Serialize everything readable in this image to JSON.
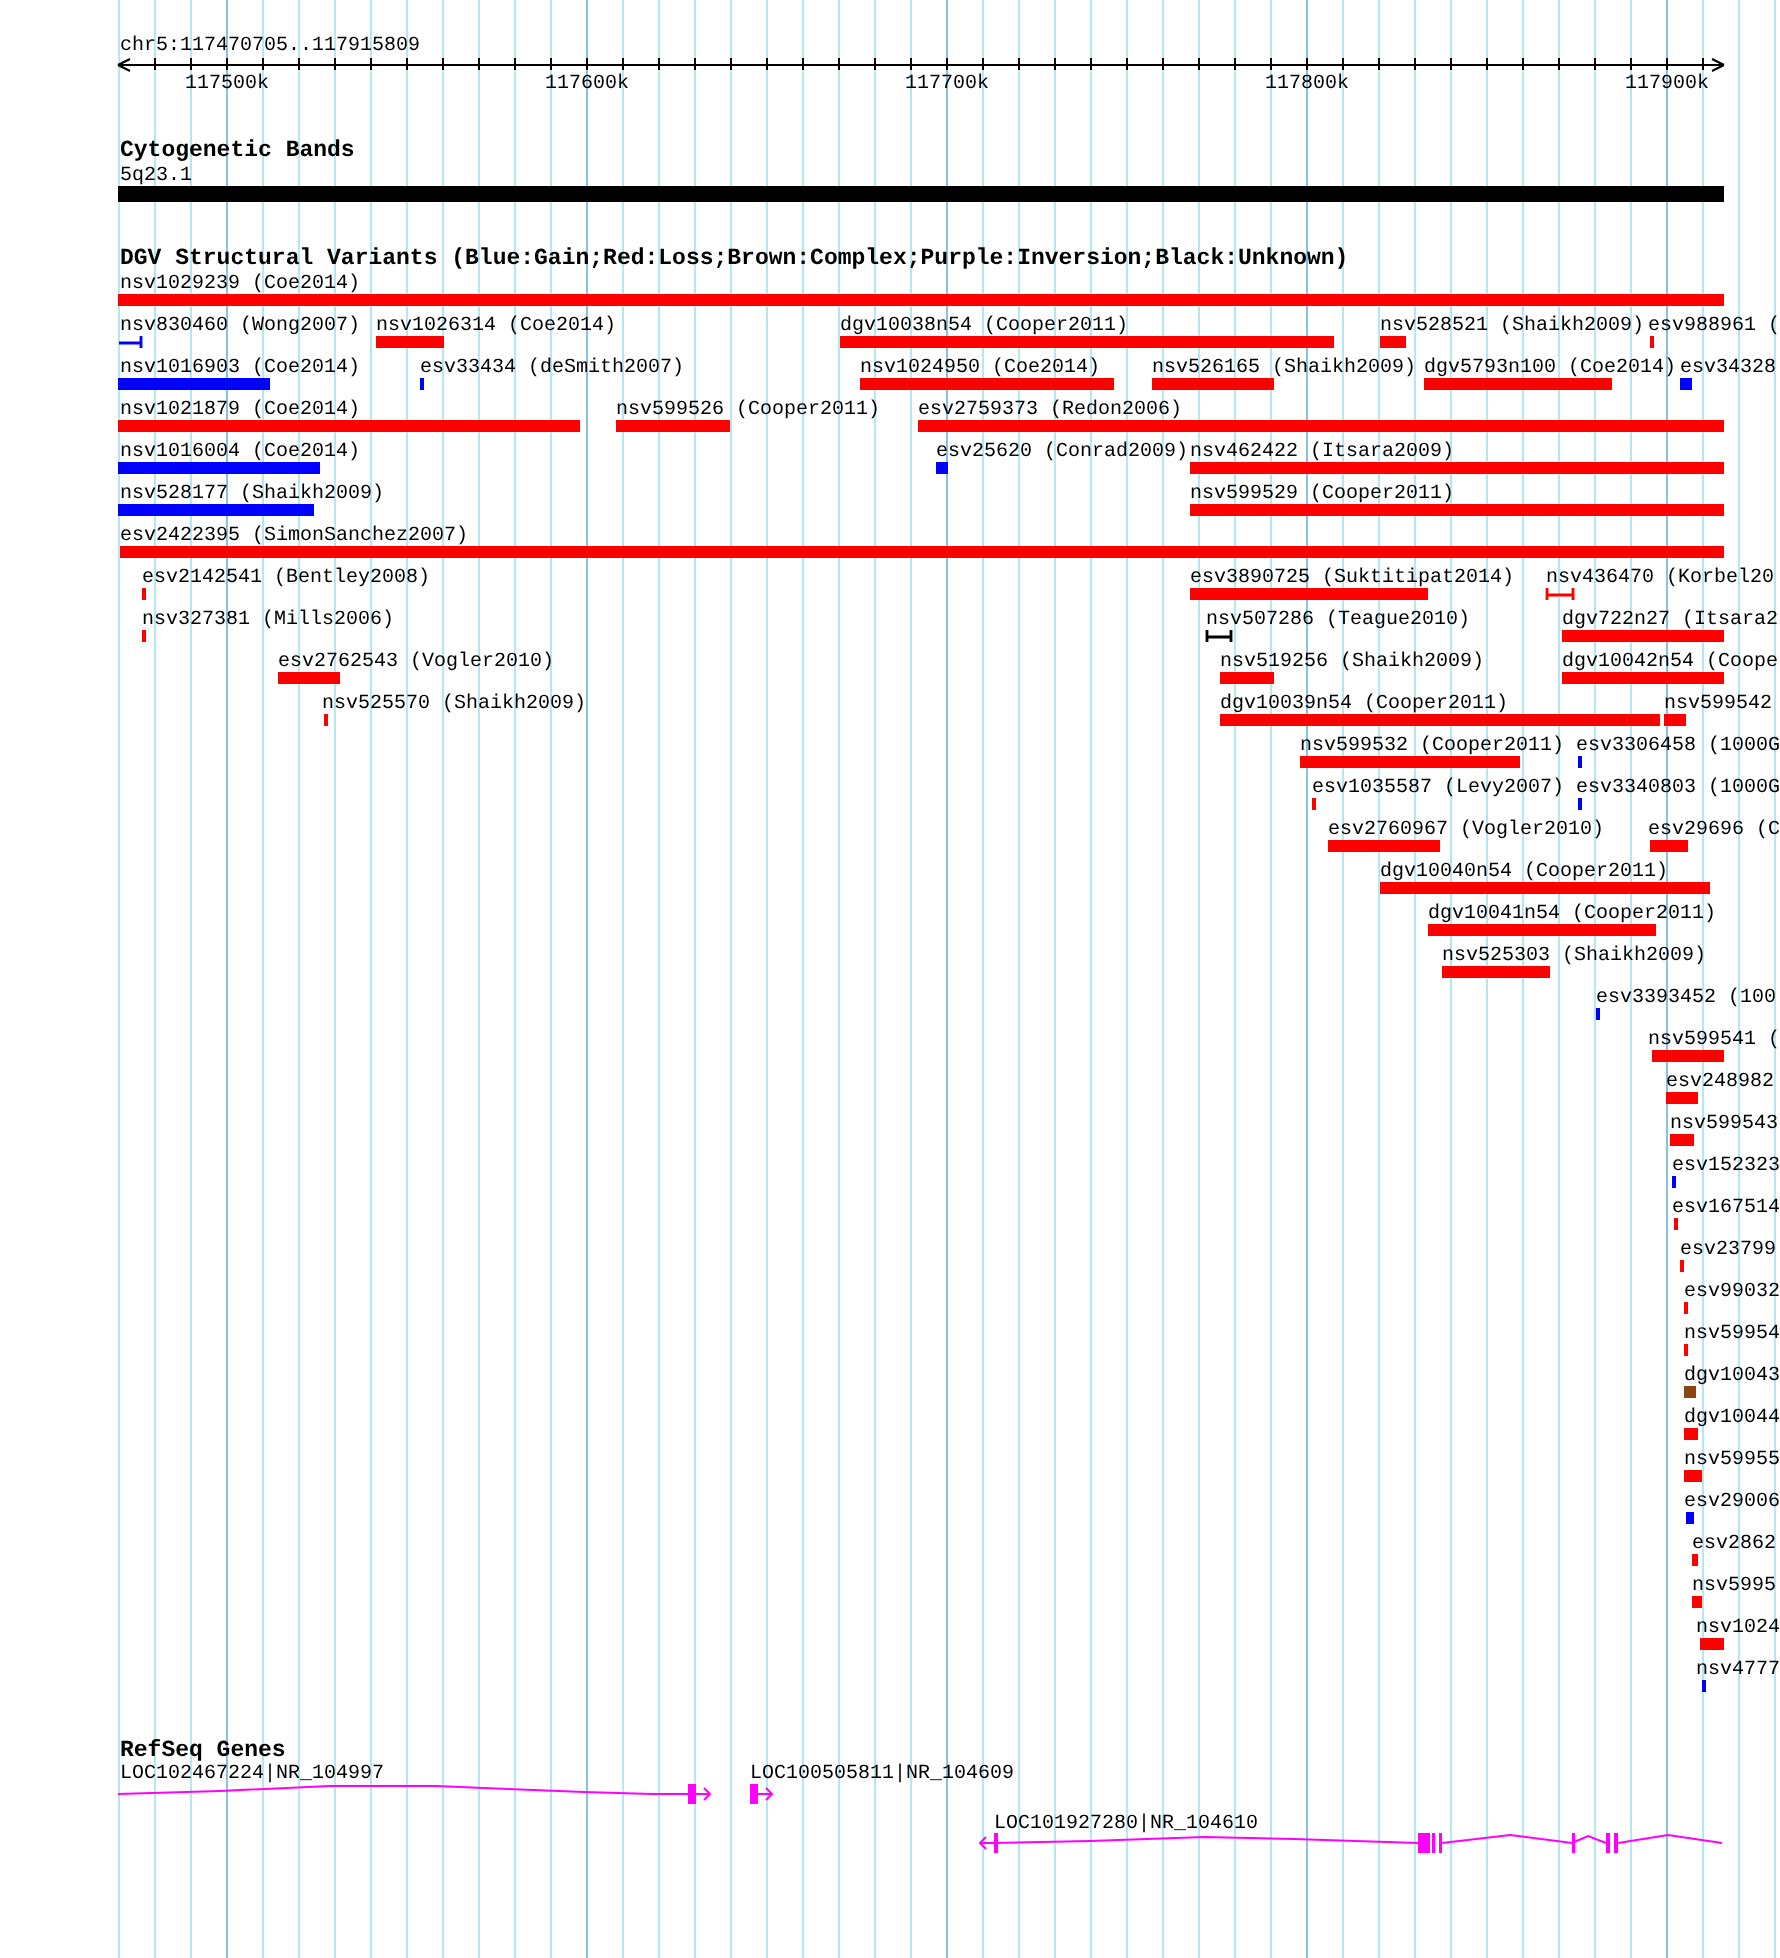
{
  "ruler": {
    "location": "chr5:117470705..117915809",
    "ticks": [
      "117500k",
      "117600k",
      "117700k",
      "117800k",
      "117900k"
    ]
  },
  "cytogenetic_bands": {
    "title": "Cytogenetic Bands",
    "bands": [
      {
        "label": "5q23.1"
      }
    ]
  },
  "dgv_structural_variants": {
    "title": "DGV Structural Variants (Blue:Gain;Red:Loss;Brown:Complex;Purple:Inversion;Black:Unknown)",
    "variants": [
      {
        "label": "nsv1029239 (Coe2014)",
        "color": "#ff0000",
        "kind": "bar"
      },
      {
        "label": "nsv830460 (Wong2007)",
        "color": "#0000ff",
        "kind": "bracket"
      },
      {
        "label": "nsv1026314 (Coe2014)",
        "color": "#ff0000",
        "kind": "bar"
      },
      {
        "label": "dgv10038n54 (Cooper2011)",
        "color": "#ff0000",
        "kind": "bar"
      },
      {
        "label": "nsv528521 (Shaikh2009)",
        "color": "#ff0000",
        "kind": "bar"
      },
      {
        "label": "esv988961 (",
        "color": "#ff0000",
        "kind": "bar"
      },
      {
        "label": "nsv1016903 (Coe2014)",
        "color": "#0000ff",
        "kind": "bar"
      },
      {
        "label": "esv33434 (deSmith2007)",
        "color": "#0000ff",
        "kind": "bar"
      },
      {
        "label": "nsv1024950 (Coe2014)",
        "color": "#ff0000",
        "kind": "bar"
      },
      {
        "label": "nsv526165 (Shaikh2009)",
        "color": "#ff0000",
        "kind": "bar"
      },
      {
        "label": "dgv5793n100 (Coe2014)",
        "color": "#ff0000",
        "kind": "bar"
      },
      {
        "label": "esv34328",
        "color": "#0000ff",
        "kind": "bar"
      },
      {
        "label": "nsv1021879 (Coe2014)",
        "color": "#ff0000",
        "kind": "bar"
      },
      {
        "label": "nsv599526 (Cooper2011)",
        "color": "#ff0000",
        "kind": "bar"
      },
      {
        "label": "esv2759373 (Redon2006)",
        "color": "#ff0000",
        "kind": "bar"
      },
      {
        "label": "nsv1016004 (Coe2014)",
        "color": "#0000ff",
        "kind": "bar"
      },
      {
        "label": "esv25620 (Conrad2009)",
        "color": "#0000ff",
        "kind": "bar"
      },
      {
        "label": "nsv462422 (Itsara2009)",
        "color": "#ff0000",
        "kind": "bar"
      },
      {
        "label": "nsv528177 (Shaikh2009)",
        "color": "#0000ff",
        "kind": "bar"
      },
      {
        "label": "nsv599529 (Cooper2011)",
        "color": "#ff0000",
        "kind": "bar"
      },
      {
        "label": "esv2422395 (SimonSanchez2007)",
        "color": "#ff0000",
        "kind": "bar"
      },
      {
        "label": "esv2142541 (Bentley2008)",
        "color": "#ff0000",
        "kind": "bar"
      },
      {
        "label": "esv3890725 (Suktitipat2014)",
        "color": "#ff0000",
        "kind": "bar"
      },
      {
        "label": "nsv436470 (Korbel20",
        "color": "#ff0000",
        "kind": "bracket"
      },
      {
        "label": "nsv327381 (Mills2006)",
        "color": "#ff0000",
        "kind": "bar"
      },
      {
        "label": "nsv507286 (Teague2010)",
        "color": "#000000",
        "kind": "bracket"
      },
      {
        "label": "dgv722n27 (Itsara2",
        "color": "#ff0000",
        "kind": "bar"
      },
      {
        "label": "esv2762543 (Vogler2010)",
        "color": "#ff0000",
        "kind": "bar"
      },
      {
        "label": "nsv519256 (Shaikh2009)",
        "color": "#ff0000",
        "kind": "bar"
      },
      {
        "label": "dgv10042n54 (Coope",
        "color": "#ff0000",
        "kind": "bar"
      },
      {
        "label": "nsv525570 (Shaikh2009)",
        "color": "#ff0000",
        "kind": "bar"
      },
      {
        "label": "dgv10039n54 (Cooper2011)",
        "color": "#ff0000",
        "kind": "bar"
      },
      {
        "label": "nsv599542",
        "color": "#ff0000",
        "kind": "bar"
      },
      {
        "label": "nsv599532 (Cooper2011)",
        "color": "#ff0000",
        "kind": "bar"
      },
      {
        "label": "esv3306458 (1000G",
        "color": "#0000ff",
        "kind": "bar"
      },
      {
        "label": "esv1035587 (Levy2007)",
        "color": "#ff0000",
        "kind": "bar"
      },
      {
        "label": "esv3340803 (1000G",
        "color": "#0000ff",
        "kind": "bar"
      },
      {
        "label": "esv2760967 (Vogler2010)",
        "color": "#ff0000",
        "kind": "bar"
      },
      {
        "label": "esv29696 (C",
        "color": "#ff0000",
        "kind": "bar"
      },
      {
        "label": "dgv10040n54 (Cooper2011)",
        "color": "#ff0000",
        "kind": "bar"
      },
      {
        "label": "dgv10041n54 (Cooper2011)",
        "color": "#ff0000",
        "kind": "bar"
      },
      {
        "label": "nsv525303 (Shaikh2009)",
        "color": "#ff0000",
        "kind": "bar"
      },
      {
        "label": "esv3393452 (100",
        "color": "#0000ff",
        "kind": "bar"
      },
      {
        "label": "nsv599541 (",
        "color": "#ff0000",
        "kind": "bar"
      },
      {
        "label": "esv248982",
        "color": "#ff0000",
        "kind": "bar"
      },
      {
        "label": "nsv599543",
        "color": "#ff0000",
        "kind": "bar"
      },
      {
        "label": "esv152323",
        "color": "#0000ff",
        "kind": "bar"
      },
      {
        "label": "esv167514",
        "color": "#ff0000",
        "kind": "bar"
      },
      {
        "label": "esv23799",
        "color": "#ff0000",
        "kind": "bar"
      },
      {
        "label": "esv99032",
        "color": "#ff0000",
        "kind": "bar"
      },
      {
        "label": "nsv59954",
        "color": "#ff0000",
        "kind": "bar"
      },
      {
        "label": "dgv10043",
        "color": "#8b4513",
        "kind": "bar"
      },
      {
        "label": "dgv10044",
        "color": "#ff0000",
        "kind": "bar"
      },
      {
        "label": "nsv59955",
        "color": "#ff0000",
        "kind": "bar"
      },
      {
        "label": "esv29006",
        "color": "#0000ff",
        "kind": "bar"
      },
      {
        "label": "esv2862",
        "color": "#ff0000",
        "kind": "bar"
      },
      {
        "label": "nsv5995",
        "color": "#ff0000",
        "kind": "bar"
      },
      {
        "label": "nsv1024",
        "color": "#ff0000",
        "kind": "bar"
      },
      {
        "label": "nsv4777",
        "color": "#0000ff",
        "kind": "bar"
      }
    ]
  },
  "refseq_genes": {
    "title": "RefSeq Genes",
    "genes": [
      {
        "label": "LOC102467224|NR_104997",
        "reverse_strand": false
      },
      {
        "label": "LOC100505811|NR_104609",
        "reverse_strand": false
      },
      {
        "label": "LOC101927280|NR_104610",
        "reverse_strand": true
      }
    ]
  }
}
